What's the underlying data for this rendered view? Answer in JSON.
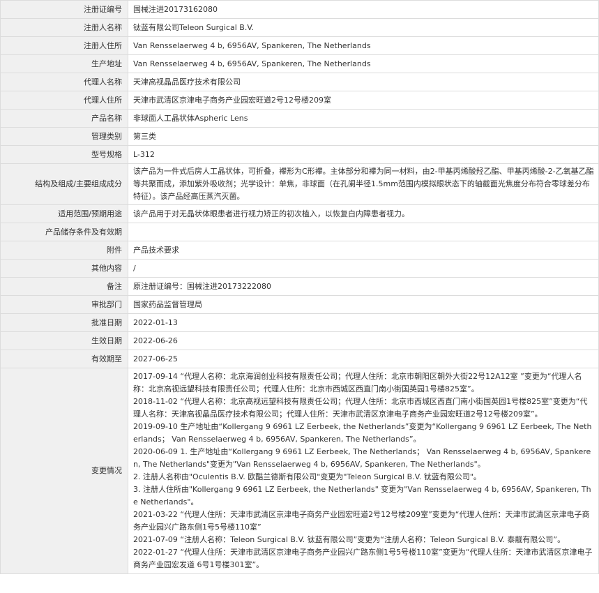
{
  "rows": [
    {
      "label": "注册证编号",
      "value": "国械注进20173162080"
    },
    {
      "label": "注册人名称",
      "value": "钛蓝有限公司Teleon Surgical B.V."
    },
    {
      "label": "注册人住所",
      "value": "Van Rensselaerweg 4 b, 6956AV, Spankeren, The Netherlands"
    },
    {
      "label": "生产地址",
      "value": "Van Rensselaerweg 4 b, 6956AV, Spankeren, The Netherlands"
    },
    {
      "label": "代理人名称",
      "value": "天津高视晶品医疗技术有限公司"
    },
    {
      "label": "代理人住所",
      "value": "天津市武清区京津电子商务产业园宏旺道2号12号楼209室"
    },
    {
      "label": "产品名称",
      "value": "非球面人工晶状体Aspheric Lens"
    },
    {
      "label": "管理类别",
      "value": "第三类"
    },
    {
      "label": "型号规格",
      "value": "L-312"
    },
    {
      "label": "结构及组成/主要组成成分",
      "value": "该产品为一件式后房人工晶状体，可折叠，襻形为C形襻。主体部分和襻为同一材料，由2-甲基丙烯酸羟乙酯、甲基丙烯酸-2-乙氧基乙酯等共聚而成，添加紫外吸收剂；光学设计：单焦，非球面（在孔阑半径1.5mm范围内模拟眼状态下的轴截面光焦度分布符合零球差分布特征）。该产品经高压蒸汽灭菌。"
    },
    {
      "label": "适用范围/预期用途",
      "value": "该产品用于对无晶状体眼患者进行视力矫正的初次植入，以恢复白内障患者视力。"
    },
    {
      "label": "产品储存条件及有效期",
      "value": ""
    },
    {
      "label": "附件",
      "value": "产品技术要求"
    },
    {
      "label": "其他内容",
      "value": "/"
    },
    {
      "label": "备注",
      "value": "原注册证编号：国械注进20173222080"
    },
    {
      "label": "审批部门",
      "value": "国家药品监督管理局"
    },
    {
      "label": "批准日期",
      "value": "2022-01-13"
    },
    {
      "label": "生效日期",
      "value": "2022-06-26"
    },
    {
      "label": "有效期至",
      "value": "2027-06-25"
    }
  ],
  "changes": {
    "label": "变更情况",
    "entries": [
      "2017-09-14 “代理人名称：北京海润创业科技有限责任公司；代理人住所：北京市朝阳区朝外大街22号12A12室 ”变更为“代理人名称：北京高视远望科技有限责任公司；代理人住所：北京市西城区西直门南小街国英园1号楼825室”。",
      "2018-11-02 “代理人名称：北京高视远望科技有限责任公司；代理人住所：北京市西城区西直门南小街国英园1号楼825室”变更为“代理人名称：天津高视晶品医疗技术有限公司；代理人住所：天津市武清区京津电子商务产业园宏旺道2号12号楼209室”。",
      "2019-09-10 生产地址由“Kollergang 9 6961 LZ Eerbeek, the Netherlands”变更为“Kollergang 9 6961 LZ Eerbeek, The Netherlands； Van Rensselaerweg 4 b, 6956AV, Spankeren, The Netherlands”。",
      "2020-06-09 1. 生产地址由“Kollergang 9 6961 LZ Eerbeek, The Netherlands； Van Rensselaerweg 4 b, 6956AV, Spankeren, The Netherlands\"变更为\"Van Rensselaerweg 4 b, 6956AV, Spankeren, The Netherlands\"。",
      "2. 注册人名称由\"Oculentis B.V. 欧酷兰德斯有限公司\"变更为\"Teleon Surgical B.V. 钛蓝有限公司\"。",
      "3. 注册人住所由\"Kollergang 9 6961 LZ Eerbeek, the Netherlands\" 变更为\"Van Rensselaerweg 4 b, 6956AV, Spankeren, The Netherlands\"。",
      "2021-03-22 “代理人住所：天津市武清区京津电子商务产业园宏旺道2号12号楼209室”变更为“代理人住所：天津市武清区京津电子商务产业园兴广路东侧1号5号楼110室”",
      "2021-07-09 “注册人名称：Teleon Surgical B.V. 钛蓝有限公司”变更为“注册人名称：Teleon Surgical B.V. 泰靓有限公司”。",
      "2022-01-27 “代理人住所：天津市武清区京津电子商务产业园兴广路东侧1号5号楼110室”变更为“代理人住所：天津市武清区京津电子商务产业园宏发道 6号1号楼301室”。"
    ]
  }
}
